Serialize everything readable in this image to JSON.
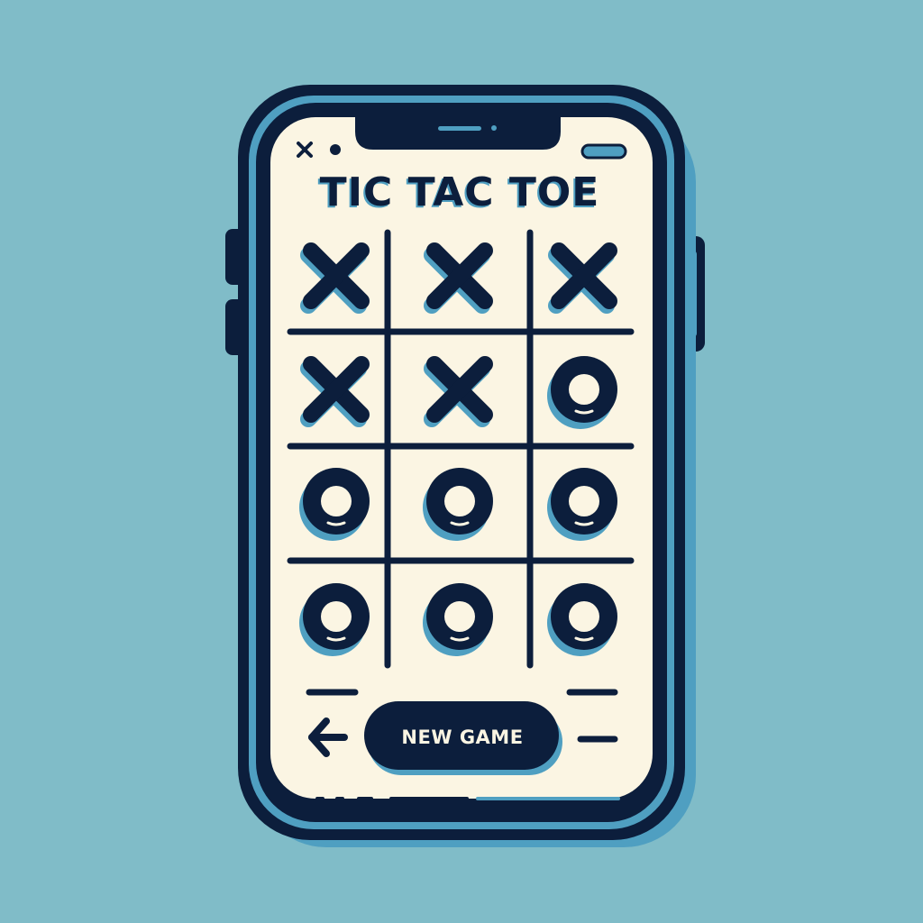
{
  "game": {
    "title": "TIC TAC TOE",
    "new_game_label": "NEW GAME",
    "status_icons": [
      "close-icon",
      "dot-icon"
    ],
    "board": [
      [
        "X",
        "X",
        "X"
      ],
      [
        "X",
        "X",
        "O"
      ],
      [
        "O",
        "O",
        "O"
      ],
      [
        "O",
        "O",
        "O"
      ]
    ]
  },
  "colors": {
    "background": "#80bcc8",
    "phone_outline": "#0c1e3c",
    "screen": "#fbf5e3",
    "accent": "#4f9fc1"
  }
}
